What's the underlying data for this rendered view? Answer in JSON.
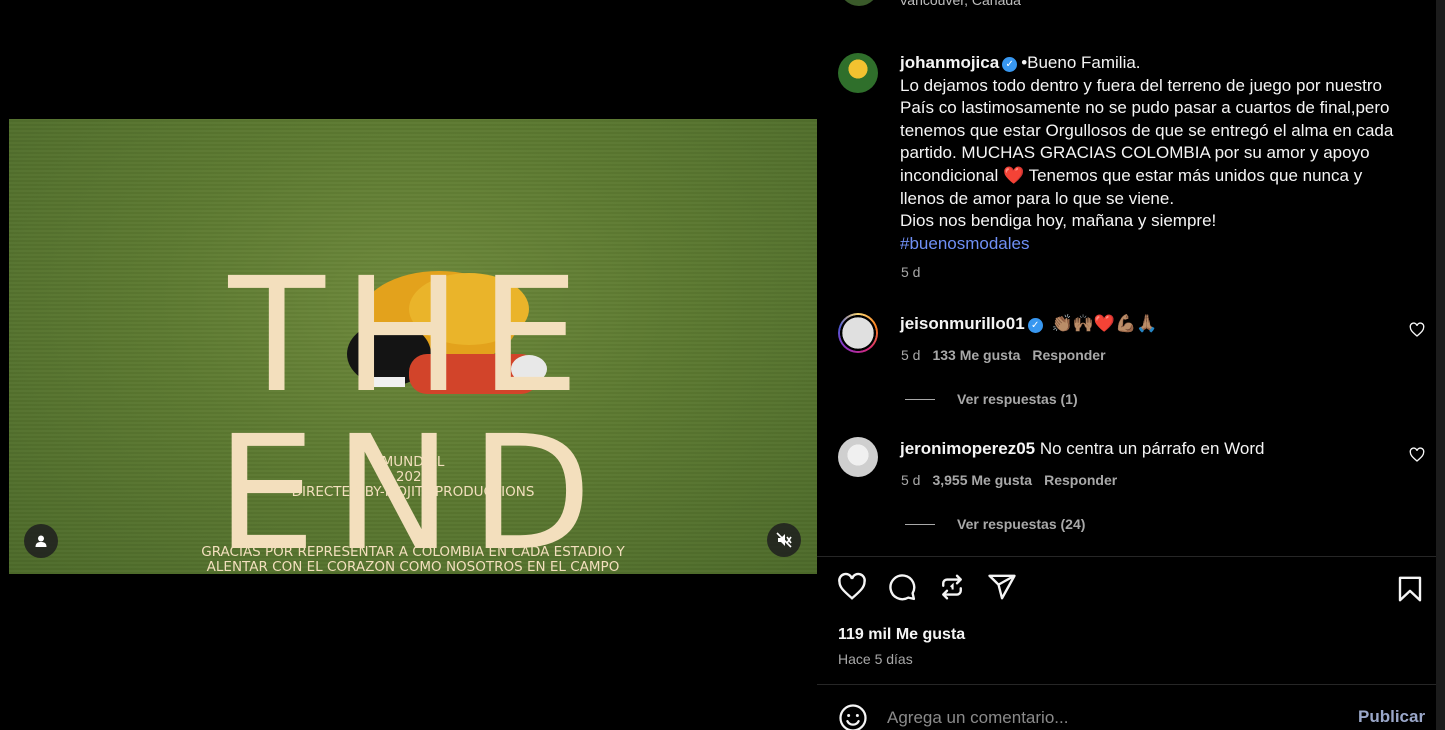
{
  "media": {
    "title": "THE END",
    "credits": {
      "line1": "MUNDIAL",
      "line2": "2026",
      "line3": "DIRECTED BY-MOJITV.PRODUCTIONS"
    },
    "footer_line1": "GRACIAS POR REPRESENTAR A COLOMBIA EN CADA ESTADIO Y",
    "footer_line2": "ALENTAR CON EL CORAZON COMO NOSOTROS EN EL CAMPO",
    "icons": {
      "tagged": "user-icon",
      "mute": "sound-off-icon"
    }
  },
  "header": {
    "location": "Vancouver, Canada"
  },
  "post": {
    "username": "johanmojica",
    "verified": true,
    "caption_lines": [
      "•Bueno Familia.",
      "Lo dejamos todo dentro y fuera del terreno de juego por nuestro",
      "País co lastimosamente no se pudo pasar a cuartos de final,pero",
      "tenemos que estar Orgullosos de que se entregó el alma en cada",
      "partido. MUCHAS GRACIAS COLOMBIA por su amor y apoyo",
      "incondicional ❤️ Tenemos que estar más unidos que nunca y",
      "llenos de amor para lo que se viene.",
      "Dios nos bendiga hoy, mañana y siempre!"
    ],
    "hashtag": "#buenosmodales",
    "time": "5 d"
  },
  "comments": [
    {
      "username": "jeisonmurillo01",
      "verified": true,
      "text": "👏🏽🙌🏽❤️💪🏽🙏🏽",
      "time": "5 d",
      "likes": "133 Me gusta",
      "reply_label": "Responder",
      "view_replies": "Ver respuestas (1)"
    },
    {
      "username": "jeronimoperez05",
      "verified": false,
      "text": "No centra un párrafo en Word",
      "time": "5 d",
      "likes": "3,955 Me gusta",
      "reply_label": "Responder",
      "view_replies": "Ver respuestas (24)"
    }
  ],
  "actions": {
    "icons": [
      "heart-icon",
      "comment-icon",
      "repost-icon",
      "share-icon",
      "bookmark-icon"
    ],
    "likes_count": "119 mil Me gusta",
    "posted_ago": "Hace 5 días"
  },
  "comment_box": {
    "placeholder": "Agrega un comentario...",
    "publish_label": "Publicar"
  }
}
